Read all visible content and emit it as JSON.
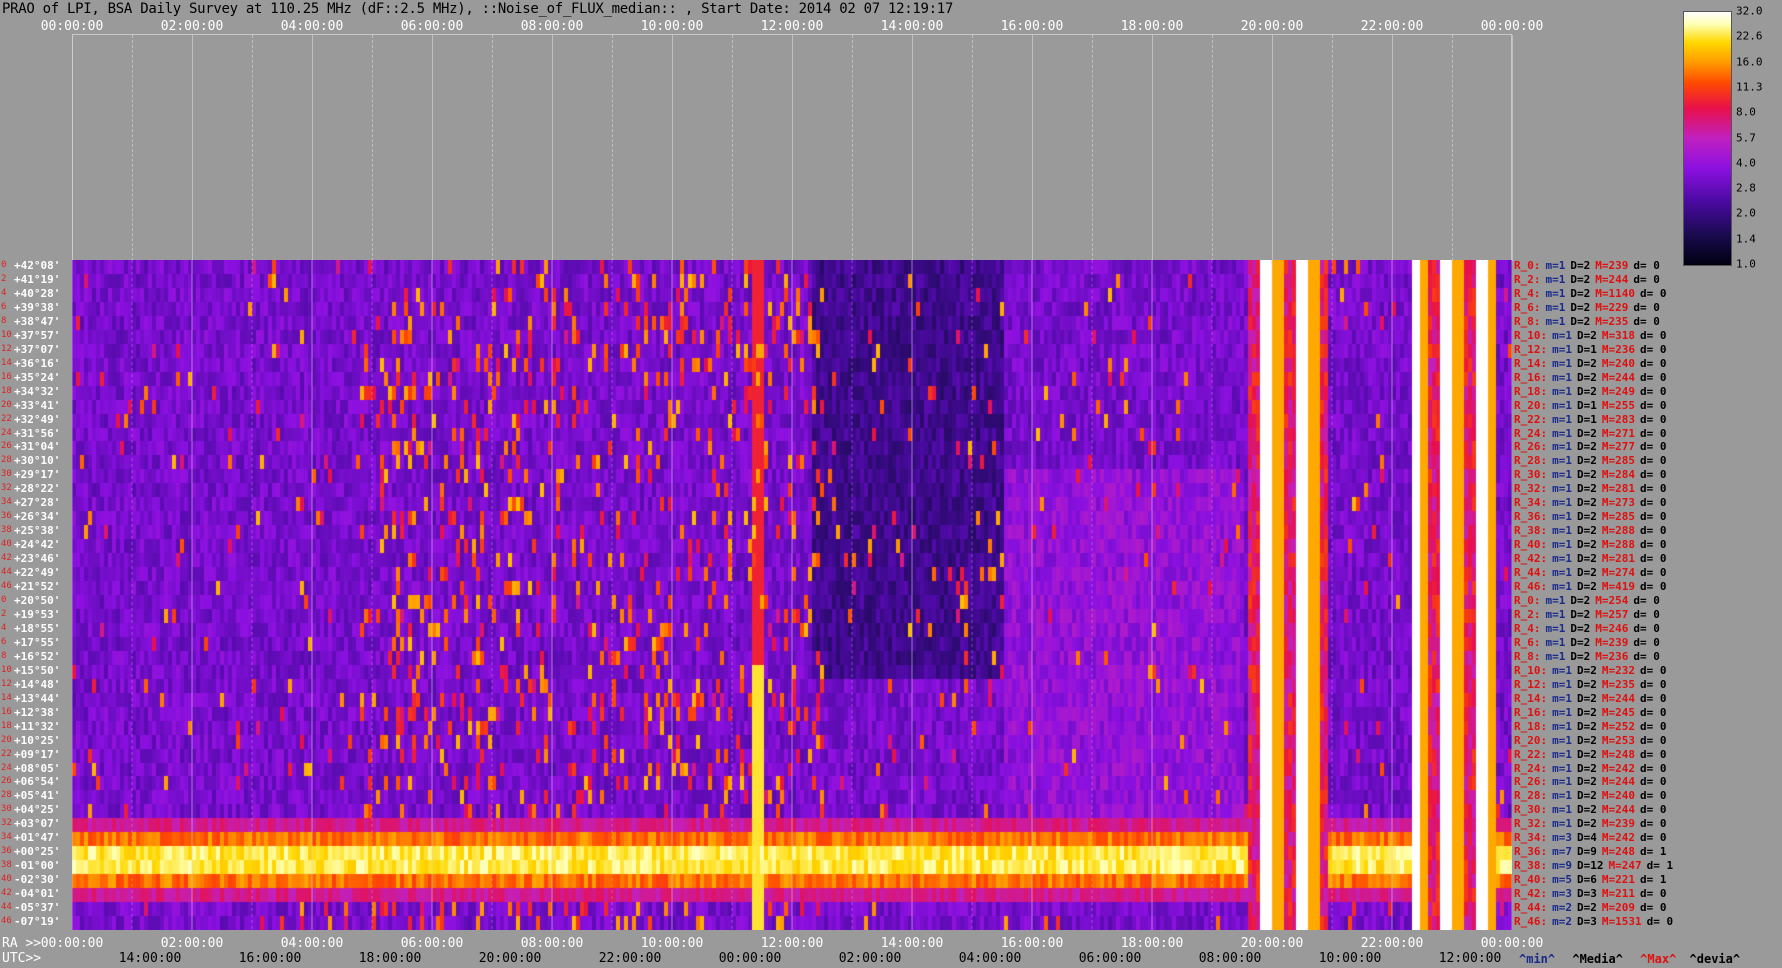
{
  "title": "PRAO of LPI, BSA Daily Survey at 110.25 MHz (dF::2.5 MHz), ::Noise_of_FLUX_median:: , Start Date: 2014 02 07 12:19:17",
  "ra_prefix": "RA >>",
  "utc_prefix": "UTC>>",
  "legend": {
    "min": "^min^",
    "median": "^Media^",
    "max": "^Max^",
    "dev": "^devia^"
  },
  "colors": {
    "min": "#1a2a8c",
    "median": "#000000",
    "max": "#e01010",
    "dev": "#000000"
  },
  "chart_data": {
    "type": "heatmap",
    "title": "PRAO of LPI, BSA Daily Survey at 110.25 MHz (dF::2.5 MHz), ::Noise_of_FLUX_median:: , Start Date: 2014 02 07 12:19:17",
    "x_top_ticks": [
      "00:00:00",
      "02:00:00",
      "04:00:00",
      "06:00:00",
      "08:00:00",
      "10:00:00",
      "12:00:00",
      "14:00:00",
      "16:00:00",
      "18:00:00",
      "20:00:00",
      "22:00:00",
      "00:00:00"
    ],
    "ra_ticks": [
      "00:00:00",
      "02:00:00",
      "04:00:00",
      "06:00:00",
      "08:00:00",
      "10:00:00",
      "12:00:00",
      "14:00:00",
      "16:00:00",
      "18:00:00",
      "20:00:00",
      "22:00:00",
      "00:00:00"
    ],
    "utc_ticks": [
      "14:00:00",
      "16:00:00",
      "18:00:00",
      "20:00:00",
      "22:00:00",
      "00:00:00",
      "02:00:00",
      "04:00:00",
      "06:00:00",
      "08:00:00",
      "10:00:00",
      "12:00:00"
    ],
    "x_range_hours": [
      0,
      24
    ],
    "declinations": [
      "+42°08'",
      "+41°19'",
      "+40°28'",
      "+39°38'",
      "+38°47'",
      "+37°57'",
      "+37°07'",
      "+36°16'",
      "+35°24'",
      "+34°32'",
      "+33°41'",
      "+32°49'",
      "+31°56'",
      "+31°04'",
      "+30°10'",
      "+29°17'",
      "+28°22'",
      "+27°28'",
      "+26°34'",
      "+25°38'",
      "+24°42'",
      "+23°46'",
      "+22°49'",
      "+21°52'",
      "+20°50'",
      "+19°53'",
      "+18°55'",
      "+17°55'",
      "+16°52'",
      "+15°50'",
      "+14°48'",
      "+13°44'",
      "+12°38'",
      "+11°32'",
      "+10°25'",
      "+09°17'",
      "+08°05'",
      "+06°54'",
      "+05°41'",
      "+04°25'",
      "+03°07'",
      "+01°47'",
      "+00°25'",
      "-01°00'",
      "-02°30'",
      "-04°01'",
      "-05°37'",
      "-07°19'"
    ],
    "row_indices": [
      "0",
      "2",
      "4",
      "6",
      "8",
      "10",
      "12",
      "14",
      "16",
      "18",
      "20",
      "22",
      "24",
      "26",
      "28",
      "30",
      "32",
      "34",
      "36",
      "38",
      "40",
      "42",
      "44",
      "46",
      "0",
      "2",
      "4",
      "6",
      "8",
      "10",
      "12",
      "14",
      "16",
      "18",
      "20",
      "22",
      "24",
      "26",
      "28",
      "30",
      "32",
      "34",
      "36",
      "38",
      "40",
      "42",
      "44",
      "46"
    ],
    "colorbar": {
      "ticks": [
        "32.0",
        "22.6",
        "16.0",
        "11.3",
        "8.0",
        "5.7",
        "4.0",
        "2.8",
        "2.0",
        "1.4",
        "1.0"
      ],
      "range": [
        1.0,
        32.0
      ],
      "scale": "log"
    },
    "row_stats": [
      {
        "r": "R_0:",
        "min": "m=1",
        "med": "D=2",
        "max": "M=239",
        "dev": "d= 0"
      },
      {
        "r": "R_2:",
        "min": "m=1",
        "med": "D=2",
        "max": "M=244",
        "dev": "d= 0"
      },
      {
        "r": "R_4:",
        "min": "m=1",
        "med": "D=2",
        "max": "M=1140",
        "dev": "d= 0"
      },
      {
        "r": "R_6:",
        "min": "m=1",
        "med": "D=2",
        "max": "M=229",
        "dev": "d= 0"
      },
      {
        "r": "R_8:",
        "min": "m=1",
        "med": "D=2",
        "max": "M=235",
        "dev": "d= 0"
      },
      {
        "r": "R_10:",
        "min": "m=1",
        "med": "D=2",
        "max": "M=318",
        "dev": "d= 0"
      },
      {
        "r": "R_12:",
        "min": "m=1",
        "med": "D=1",
        "max": "M=236",
        "dev": "d= 0"
      },
      {
        "r": "R_14:",
        "min": "m=1",
        "med": "D=2",
        "max": "M=240",
        "dev": "d= 0"
      },
      {
        "r": "R_16:",
        "min": "m=1",
        "med": "D=2",
        "max": "M=244",
        "dev": "d= 0"
      },
      {
        "r": "R_18:",
        "min": "m=1",
        "med": "D=2",
        "max": "M=249",
        "dev": "d= 0"
      },
      {
        "r": "R_20:",
        "min": "m=1",
        "med": "D=1",
        "max": "M=255",
        "dev": "d= 0"
      },
      {
        "r": "R_22:",
        "min": "m=1",
        "med": "D=1",
        "max": "M=283",
        "dev": "d= 0"
      },
      {
        "r": "R_24:",
        "min": "m=1",
        "med": "D=2",
        "max": "M=271",
        "dev": "d= 0"
      },
      {
        "r": "R_26:",
        "min": "m=1",
        "med": "D=2",
        "max": "M=277",
        "dev": "d= 0"
      },
      {
        "r": "R_28:",
        "min": "m=1",
        "med": "D=2",
        "max": "M=285",
        "dev": "d= 0"
      },
      {
        "r": "R_30:",
        "min": "m=1",
        "med": "D=2",
        "max": "M=284",
        "dev": "d= 0"
      },
      {
        "r": "R_32:",
        "min": "m=1",
        "med": "D=2",
        "max": "M=281",
        "dev": "d= 0"
      },
      {
        "r": "R_34:",
        "min": "m=1",
        "med": "D=2",
        "max": "M=273",
        "dev": "d= 0"
      },
      {
        "r": "R_36:",
        "min": "m=1",
        "med": "D=2",
        "max": "M=285",
        "dev": "d= 0"
      },
      {
        "r": "R_38:",
        "min": "m=1",
        "med": "D=2",
        "max": "M=288",
        "dev": "d= 0"
      },
      {
        "r": "R_40:",
        "min": "m=1",
        "med": "D=2",
        "max": "M=288",
        "dev": "d= 0"
      },
      {
        "r": "R_42:",
        "min": "m=1",
        "med": "D=2",
        "max": "M=281",
        "dev": "d= 0"
      },
      {
        "r": "R_44:",
        "min": "m=1",
        "med": "D=2",
        "max": "M=274",
        "dev": "d= 0"
      },
      {
        "r": "R_46:",
        "min": "m=1",
        "med": "D=2",
        "max": "M=419",
        "dev": "d= 0"
      },
      {
        "r": "R_0:",
        "min": "m=1",
        "med": "D=2",
        "max": "M=254",
        "dev": "d= 0"
      },
      {
        "r": "R_2:",
        "min": "m=1",
        "med": "D=2",
        "max": "M=257",
        "dev": "d= 0"
      },
      {
        "r": "R_4:",
        "min": "m=1",
        "med": "D=2",
        "max": "M=246",
        "dev": "d= 0"
      },
      {
        "r": "R_6:",
        "min": "m=1",
        "med": "D=2",
        "max": "M=239",
        "dev": "d= 0"
      },
      {
        "r": "R_8:",
        "min": "m=1",
        "med": "D=2",
        "max": "M=236",
        "dev": "d= 0"
      },
      {
        "r": "R_10:",
        "min": "m=1",
        "med": "D=2",
        "max": "M=232",
        "dev": "d= 0"
      },
      {
        "r": "R_12:",
        "min": "m=1",
        "med": "D=2",
        "max": "M=235",
        "dev": "d= 0"
      },
      {
        "r": "R_14:",
        "min": "m=1",
        "med": "D=2",
        "max": "M=244",
        "dev": "d= 0"
      },
      {
        "r": "R_16:",
        "min": "m=1",
        "med": "D=2",
        "max": "M=245",
        "dev": "d= 0"
      },
      {
        "r": "R_18:",
        "min": "m=1",
        "med": "D=2",
        "max": "M=252",
        "dev": "d= 0"
      },
      {
        "r": "R_20:",
        "min": "m=1",
        "med": "D=2",
        "max": "M=253",
        "dev": "d= 0"
      },
      {
        "r": "R_22:",
        "min": "m=1",
        "med": "D=2",
        "max": "M=248",
        "dev": "d= 0"
      },
      {
        "r": "R_24:",
        "min": "m=1",
        "med": "D=2",
        "max": "M=242",
        "dev": "d= 0"
      },
      {
        "r": "R_26:",
        "min": "m=1",
        "med": "D=2",
        "max": "M=244",
        "dev": "d= 0"
      },
      {
        "r": "R_28:",
        "min": "m=1",
        "med": "D=2",
        "max": "M=240",
        "dev": "d= 0"
      },
      {
        "r": "R_30:",
        "min": "m=1",
        "med": "D=2",
        "max": "M=244",
        "dev": "d= 0"
      },
      {
        "r": "R_32:",
        "min": "m=1",
        "med": "D=2",
        "max": "M=239",
        "dev": "d= 0"
      },
      {
        "r": "R_34:",
        "min": "m=3",
        "med": "D=4",
        "max": "M=242",
        "dev": "d= 0"
      },
      {
        "r": "R_36:",
        "min": "m=7",
        "med": "D=9",
        "max": "M=248",
        "dev": "d= 1"
      },
      {
        "r": "R_38:",
        "min": "m=9",
        "med": "D=12",
        "max": "M=247",
        "dev": "d= 1"
      },
      {
        "r": "R_40:",
        "min": "m=5",
        "med": "D=6",
        "max": "M=221",
        "dev": "d= 1"
      },
      {
        "r": "R_42:",
        "min": "m=3",
        "med": "D=3",
        "max": "M=211",
        "dev": "d= 0"
      },
      {
        "r": "R_44:",
        "min": "m=2",
        "med": "D=2",
        "max": "M=209",
        "dev": "d= 0"
      },
      {
        "r": "R_46:",
        "min": "m=2",
        "med": "D=3",
        "max": "M=1531",
        "dev": "d= 0"
      }
    ],
    "features": {
      "bright_band_rows": [
        "+00°25'",
        "-01°00'",
        "-02°30'"
      ],
      "interference_hours": [
        [
          19.6,
          20.9
        ],
        [
          22.4,
          23.7
        ]
      ],
      "strong_source_hour": 11.4
    }
  }
}
